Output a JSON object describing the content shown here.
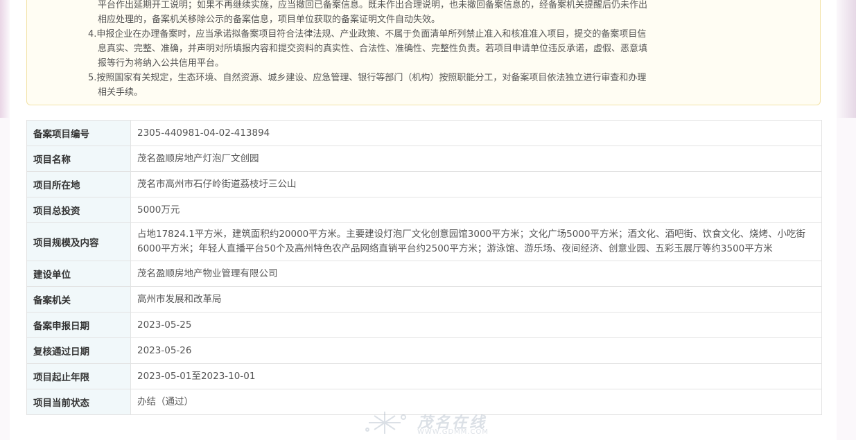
{
  "notice": {
    "lines": [
      "平台作出延期开工说明；如果不再继续实施，应当撤回已备案信息。既未作出合理说明，也未撤回备案信息的，经备案机关提醒后仍未作出",
      "相应处理的，备案机关移除公示的备案信息，项目单位获取的备案证明文件自动失效。",
      "4.申报企业在办理备案时，应当承诺拟备案项目符合法律法规、产业政策、不属于负面清单所列禁止准入和核准准入项目，提交的备案项目信",
      "息真实、完整、准确，并声明对所填报内容和提交资料的真实性、合法性、准确性、完整性负责。若项目申请单位违反承诺，虚假、恶意填",
      "报等行为将纳入公共信用平台。",
      "5.按照国家有关规定，生态环境、自然资源、城乡建设、应急管理、银行等部门（机构）按照职能分工，对备案项目依法独立进行审查和办理",
      "相关手续。"
    ]
  },
  "table": {
    "rows": [
      {
        "label": "备案项目编号",
        "value": "2305-440981-04-02-413894"
      },
      {
        "label": "项目名称",
        "value": "茂名盈顺房地产灯泡厂文创园"
      },
      {
        "label": "项目所在地",
        "value": "茂名市高州市石仔岭街道荔枝圩三公山"
      },
      {
        "label": "项目总投资",
        "value": "5000万元"
      },
      {
        "label": "项目规模及内容",
        "value": "占地17824.1平方米，建筑面积约20000平方米。主要建设灯泡厂文化创意园馆3000平方米；文化广场5000平方米；酒文化、酒吧街、饮食文化、烧烤、小吃街6000平方米；年轻人直播平台50个及高州特色农产品网络直销平台约2500平方米；游泳馆、游乐场、夜间经济、创意业园、五彩玉展厅等约3500平方米"
      },
      {
        "label": "建设单位",
        "value": "茂名盈顺房地产物业管理有限公司"
      },
      {
        "label": "备案机关",
        "value": "高州市发展和改革局"
      },
      {
        "label": "备案申报日期",
        "value": "2023-05-25"
      },
      {
        "label": "复核通过日期",
        "value": "2023-05-26"
      },
      {
        "label": "项目起止年限",
        "value": "2023-05-01至2023-10-01"
      },
      {
        "label": "项目当前状态",
        "value": "办结（通过）"
      }
    ]
  },
  "watermark": {
    "brand": "茂名在线",
    "url": "WWW.GDMM.COM"
  }
}
